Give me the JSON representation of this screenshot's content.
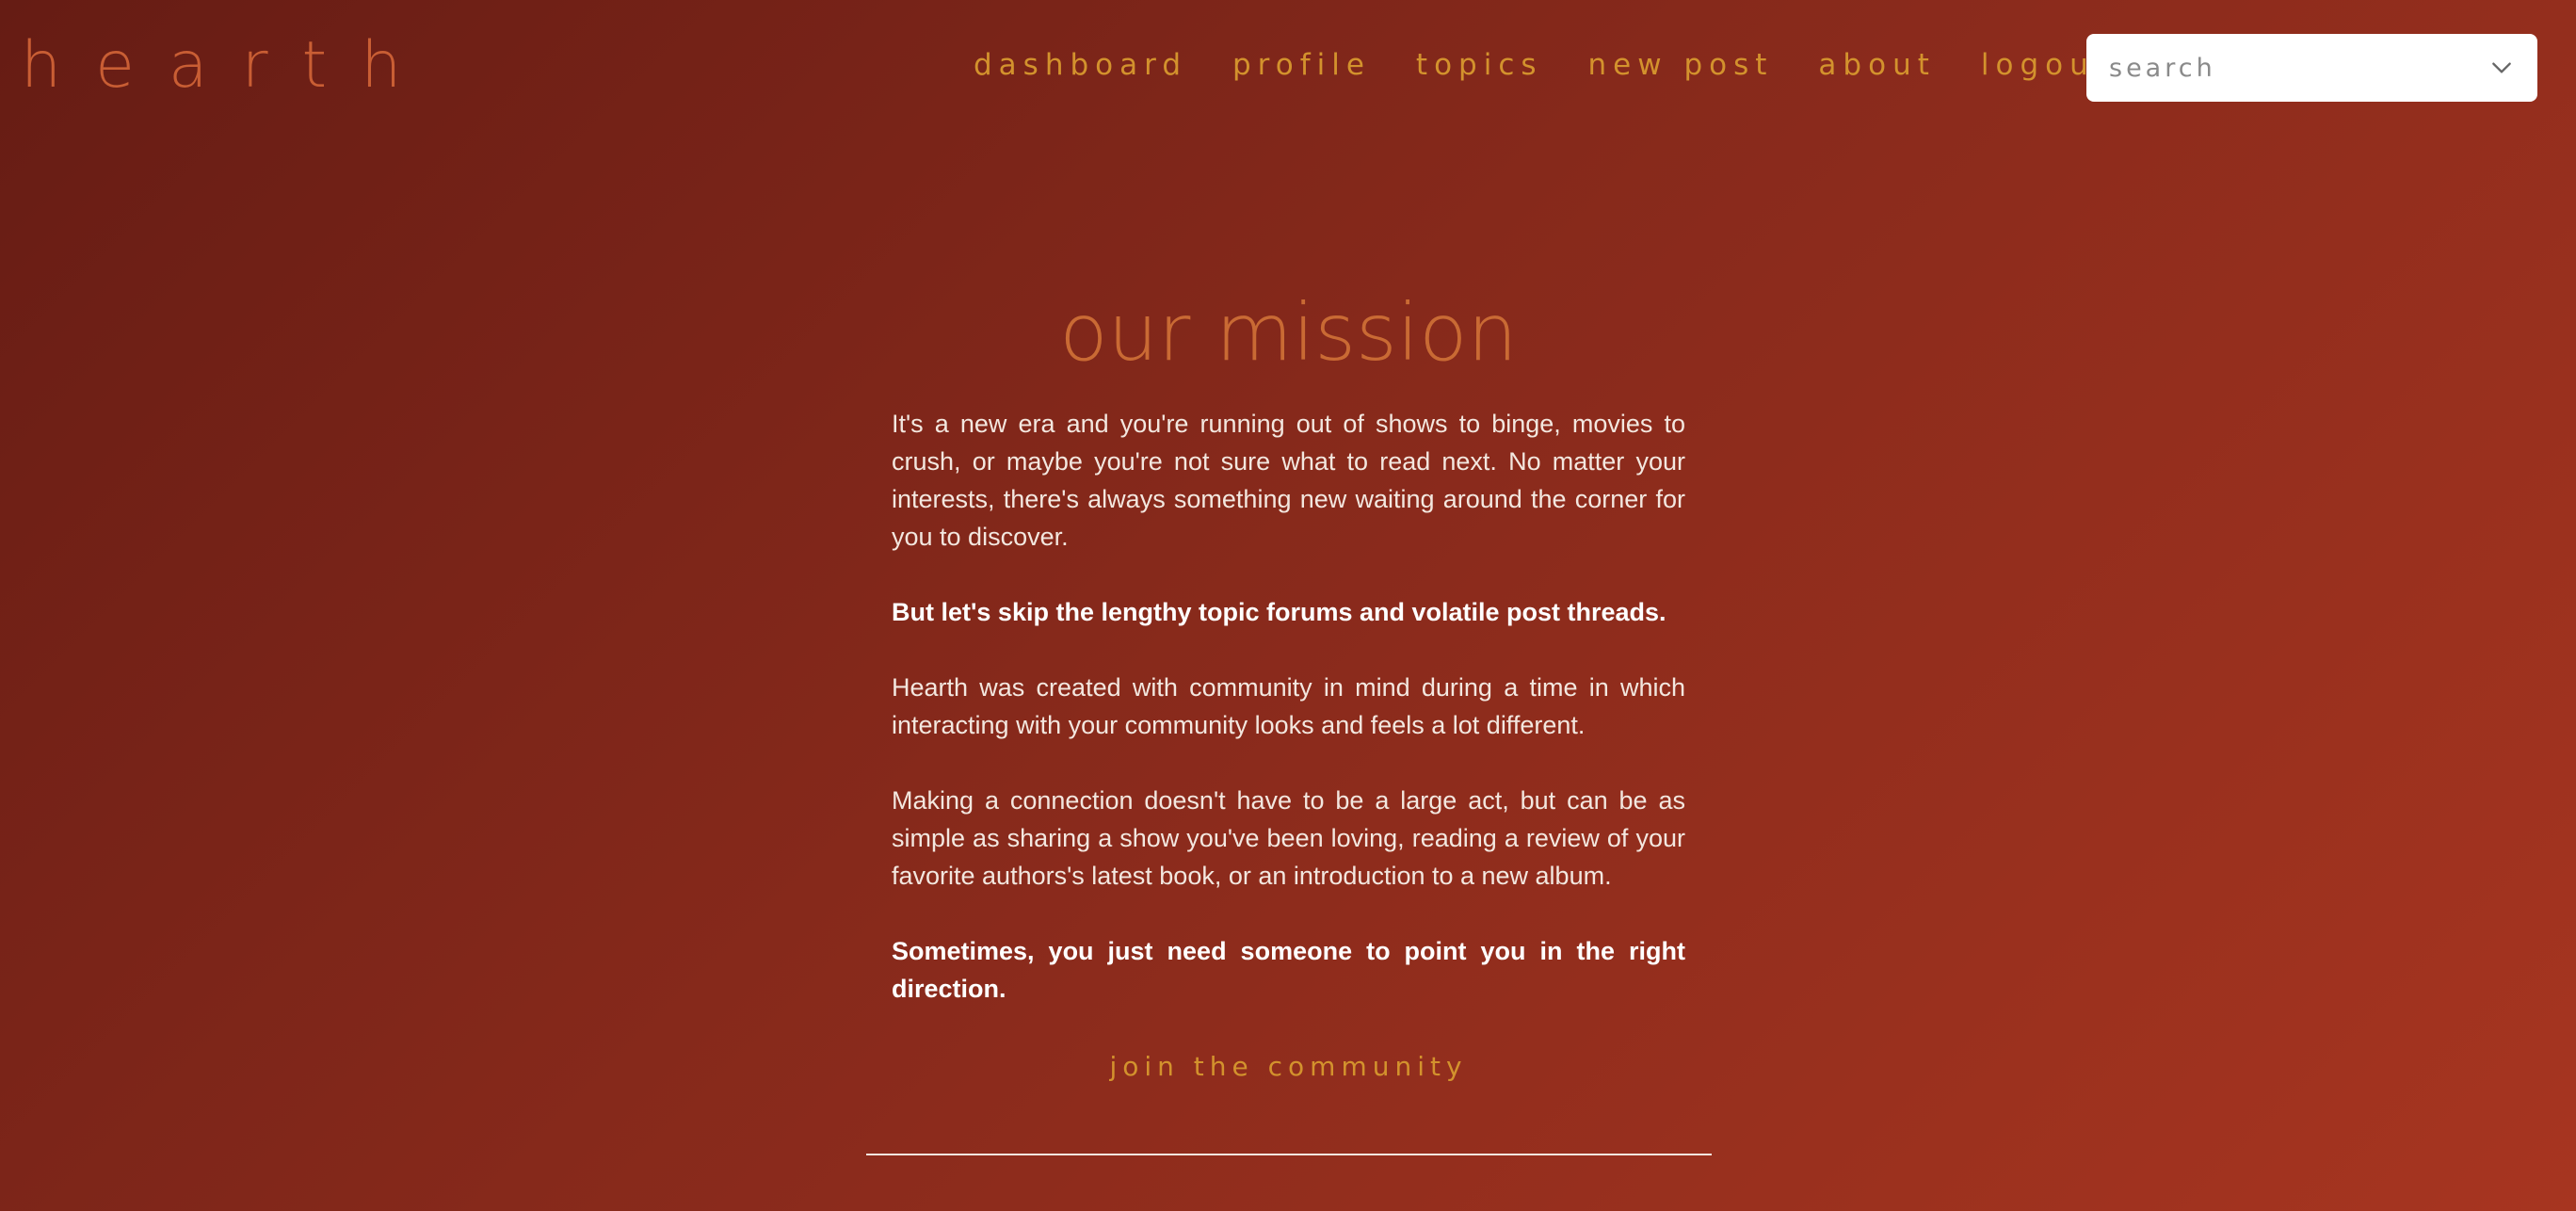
{
  "brand": {
    "name": "hearth"
  },
  "nav": {
    "items": [
      {
        "label": "dashboard"
      },
      {
        "label": "profile"
      },
      {
        "label": "topics"
      },
      {
        "label": "new post"
      },
      {
        "label": "about"
      },
      {
        "label": "logout"
      }
    ],
    "settings_icon": "gear-icon"
  },
  "search": {
    "placeholder": "search",
    "value": "",
    "dropdown_icon": "chevron-down-icon"
  },
  "main": {
    "title": "our mission",
    "paragraphs": [
      "It's a new era and you're running out of shows to binge, movies to crush, or maybe you're not sure what to read next. No matter your interests, there's always something new waiting around the corner for you to discover.",
      "But let's skip the lengthy topic forums and volatile post threads.",
      "Hearth was created with community in mind during a time in which interacting with your community looks and feels a lot different.",
      "Making a connection doesn't have to be a large act, but can be as simple as sharing a show you've been loving, reading a review of your favorite authors's latest book, or an introduction to a new album.",
      "Sometimes, you just need someone to point you in the right direction."
    ],
    "cta_label": "join the community"
  },
  "colors": {
    "background_start": "#661c14",
    "background_end": "#a73520",
    "brand": "#c95e34",
    "nav_link": "#d3922d",
    "title": "#c96a34",
    "body_text": "#f3e7df"
  }
}
